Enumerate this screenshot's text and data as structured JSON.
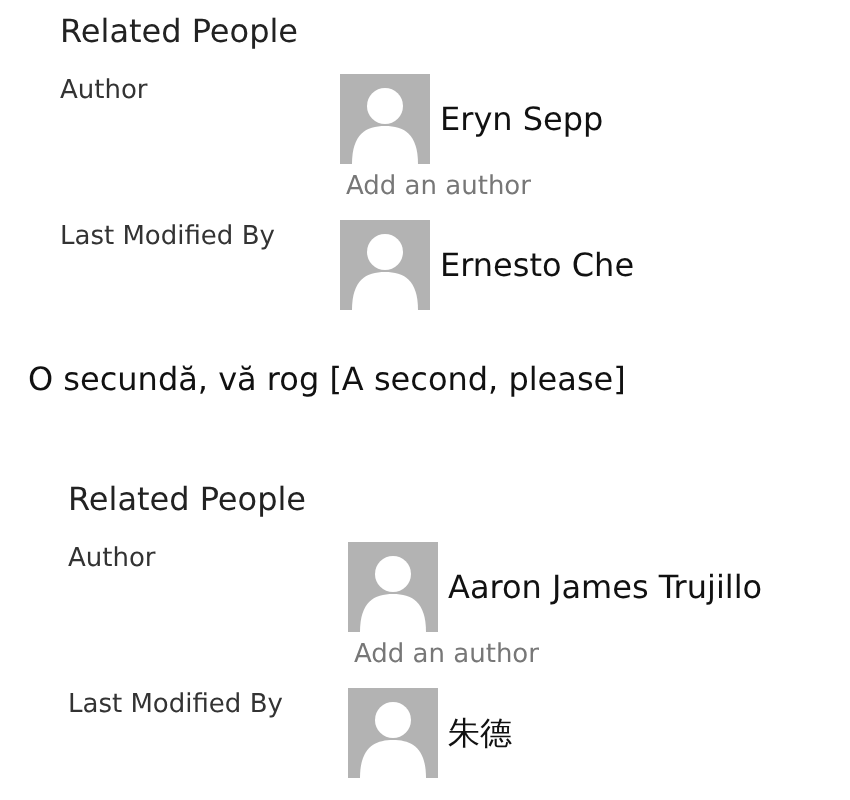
{
  "sections": [
    {
      "kind": "panel",
      "title": "Related People",
      "rows": [
        {
          "label": "Author",
          "person": "Eryn Sepp",
          "add_link": "Add an author"
        },
        {
          "label": "Last Modified By",
          "person": "Ernesto Che"
        }
      ]
    },
    {
      "kind": "caption",
      "text": "O secundă, vă rog [A second, please]"
    },
    {
      "kind": "panel",
      "title": "Related People",
      "rows": [
        {
          "label": "Author",
          "person": "Aaron James Trujillo",
          "add_link": "Add an author"
        },
        {
          "label": "Last Modified By",
          "person": "朱德"
        }
      ]
    }
  ]
}
